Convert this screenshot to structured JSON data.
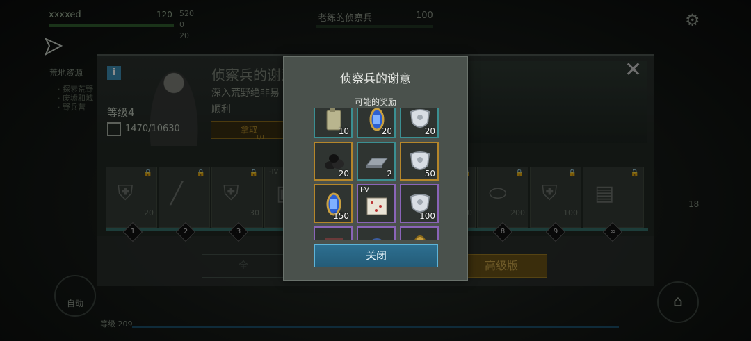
{
  "hud": {
    "player_name": "xxxxed",
    "player_hp": "120",
    "stats": [
      "520",
      "0",
      "20"
    ],
    "target_name": "老练的侦察兵",
    "target_hp": "100",
    "icons": [
      "send-icon",
      "gear-icon"
    ],
    "side_label": "荒地资源",
    "side_text": [
      "· 探索荒野",
      "· 废墟和城",
      "· 野兵营"
    ],
    "auto_label": "自动",
    "bottom_level": "等级 209",
    "right_num": "18"
  },
  "panel": {
    "title": "侦察兵的谢意",
    "desc_line1": "深入荒野绝非易",
    "desc_line2": "顺利",
    "level": "等级4",
    "xp": "1470/10630",
    "claim_label": "拿取",
    "claim_counter": "1/1",
    "premium_label": "高级版",
    "free_label": "全",
    "track_tiles": [
      {
        "amount": "20",
        "icon": "armor-icon"
      },
      {
        "amount": "",
        "icon": "rifle-icon"
      },
      {
        "amount": "30",
        "icon": "armor-icon"
      },
      {
        "amount": "",
        "icon": "crate-icon"
      },
      {
        "amount": "0",
        "icon": "armor-icon"
      },
      {
        "amount": "200",
        "icon": "capsule-icon"
      },
      {
        "amount": "100",
        "icon": "armor-icon"
      },
      {
        "amount": "",
        "icon": "chest-icon"
      }
    ],
    "track_tag": "I-IV",
    "track_nodes": [
      "1",
      "2",
      "3",
      "8",
      "9",
      "∞"
    ]
  },
  "modal": {
    "title": "侦察兵的谢意",
    "subtitle": "可能的奖励",
    "close_label": "关闭",
    "rewards": [
      {
        "icon": "fuel-can-icon",
        "qty": "10",
        "rarity": "teal",
        "tag": ""
      },
      {
        "icon": "blue-capsule-icon",
        "qty": "20",
        "rarity": "teal",
        "tag": ""
      },
      {
        "icon": "armor-plate-icon",
        "qty": "20",
        "rarity": "teal",
        "tag": ""
      },
      {
        "icon": "coal-icon",
        "qty": "20",
        "rarity": "gold",
        "tag": ""
      },
      {
        "icon": "steel-ingot-icon",
        "qty": "2",
        "rarity": "teal",
        "tag": ""
      },
      {
        "icon": "armor-plate-icon",
        "qty": "50",
        "rarity": "gold",
        "tag": ""
      },
      {
        "icon": "blue-capsule-icon",
        "qty": "150",
        "rarity": "gold",
        "tag": ""
      },
      {
        "icon": "dice-box-icon",
        "qty": "",
        "rarity": "purple",
        "tag": "I-V"
      },
      {
        "icon": "armor-plate-icon",
        "qty": "100",
        "rarity": "purple",
        "tag": ""
      },
      {
        "icon": "bundle-icon",
        "qty": "",
        "rarity": "purple",
        "tag": ""
      },
      {
        "icon": "gear-part-icon",
        "qty": "",
        "rarity": "purple",
        "tag": ""
      },
      {
        "icon": "gold-capsule-icon",
        "qty": "",
        "rarity": "purple",
        "tag": ""
      }
    ]
  }
}
